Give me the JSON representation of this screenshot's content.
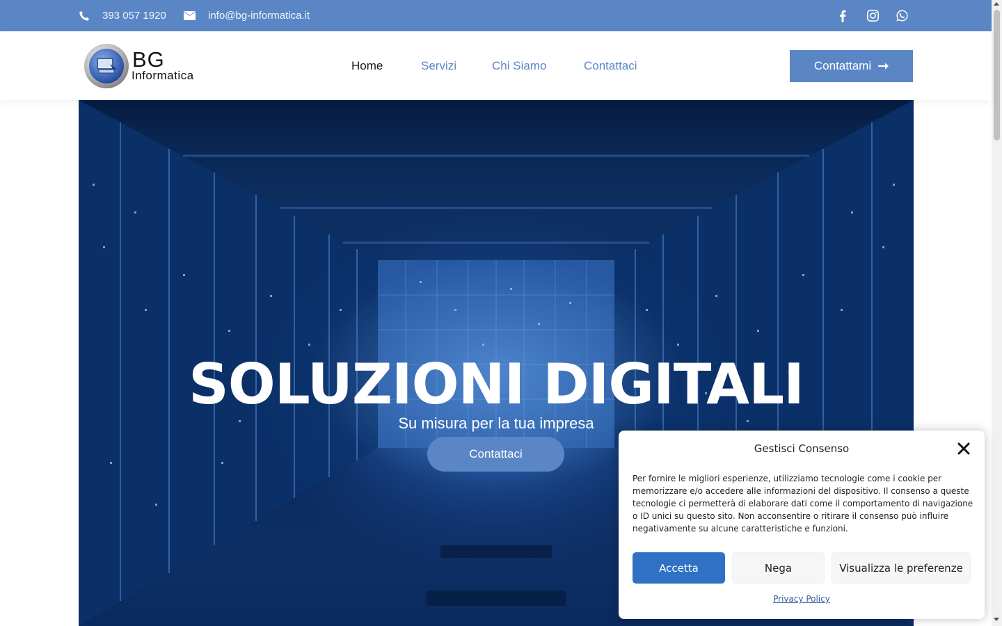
{
  "topbar": {
    "phone": "393 057 1920",
    "email": "info@bg-informatica.it",
    "social": [
      "facebook-icon",
      "instagram-icon",
      "whatsapp-icon"
    ]
  },
  "header": {
    "logo_title": "BG",
    "logo_subtitle": "Informatica",
    "nav": [
      "Home",
      "Servizi",
      "Chi Siamo",
      "Contattaci"
    ],
    "cta_label": "Contattami"
  },
  "hero": {
    "title": "SOLUZIONI DIGITALI",
    "subtitle": "Su misura per la tua impresa",
    "button_label": "Contattaci"
  },
  "consent": {
    "title": "Gestisci Consenso",
    "text": "Per fornire le migliori esperienze, utilizziamo tecnologie come i cookie per memorizzare e/o accedere alle informazioni del dispositivo. Il consenso a queste tecnologie ci permetterà di elaborare dati come il comportamento di navigazione o ID unici su questo sito. Non acconsentire o ritirare il consenso può influire negativamente su alcune caratteristiche e funzioni.",
    "accept_label": "Accetta",
    "deny_label": "Nega",
    "prefs_label": "Visualizza le preferenze",
    "privacy_label": "Privacy Policy"
  },
  "colors": {
    "brand": "#5b86c6",
    "accept": "#2f72c4",
    "hero_dark": "#082452"
  }
}
